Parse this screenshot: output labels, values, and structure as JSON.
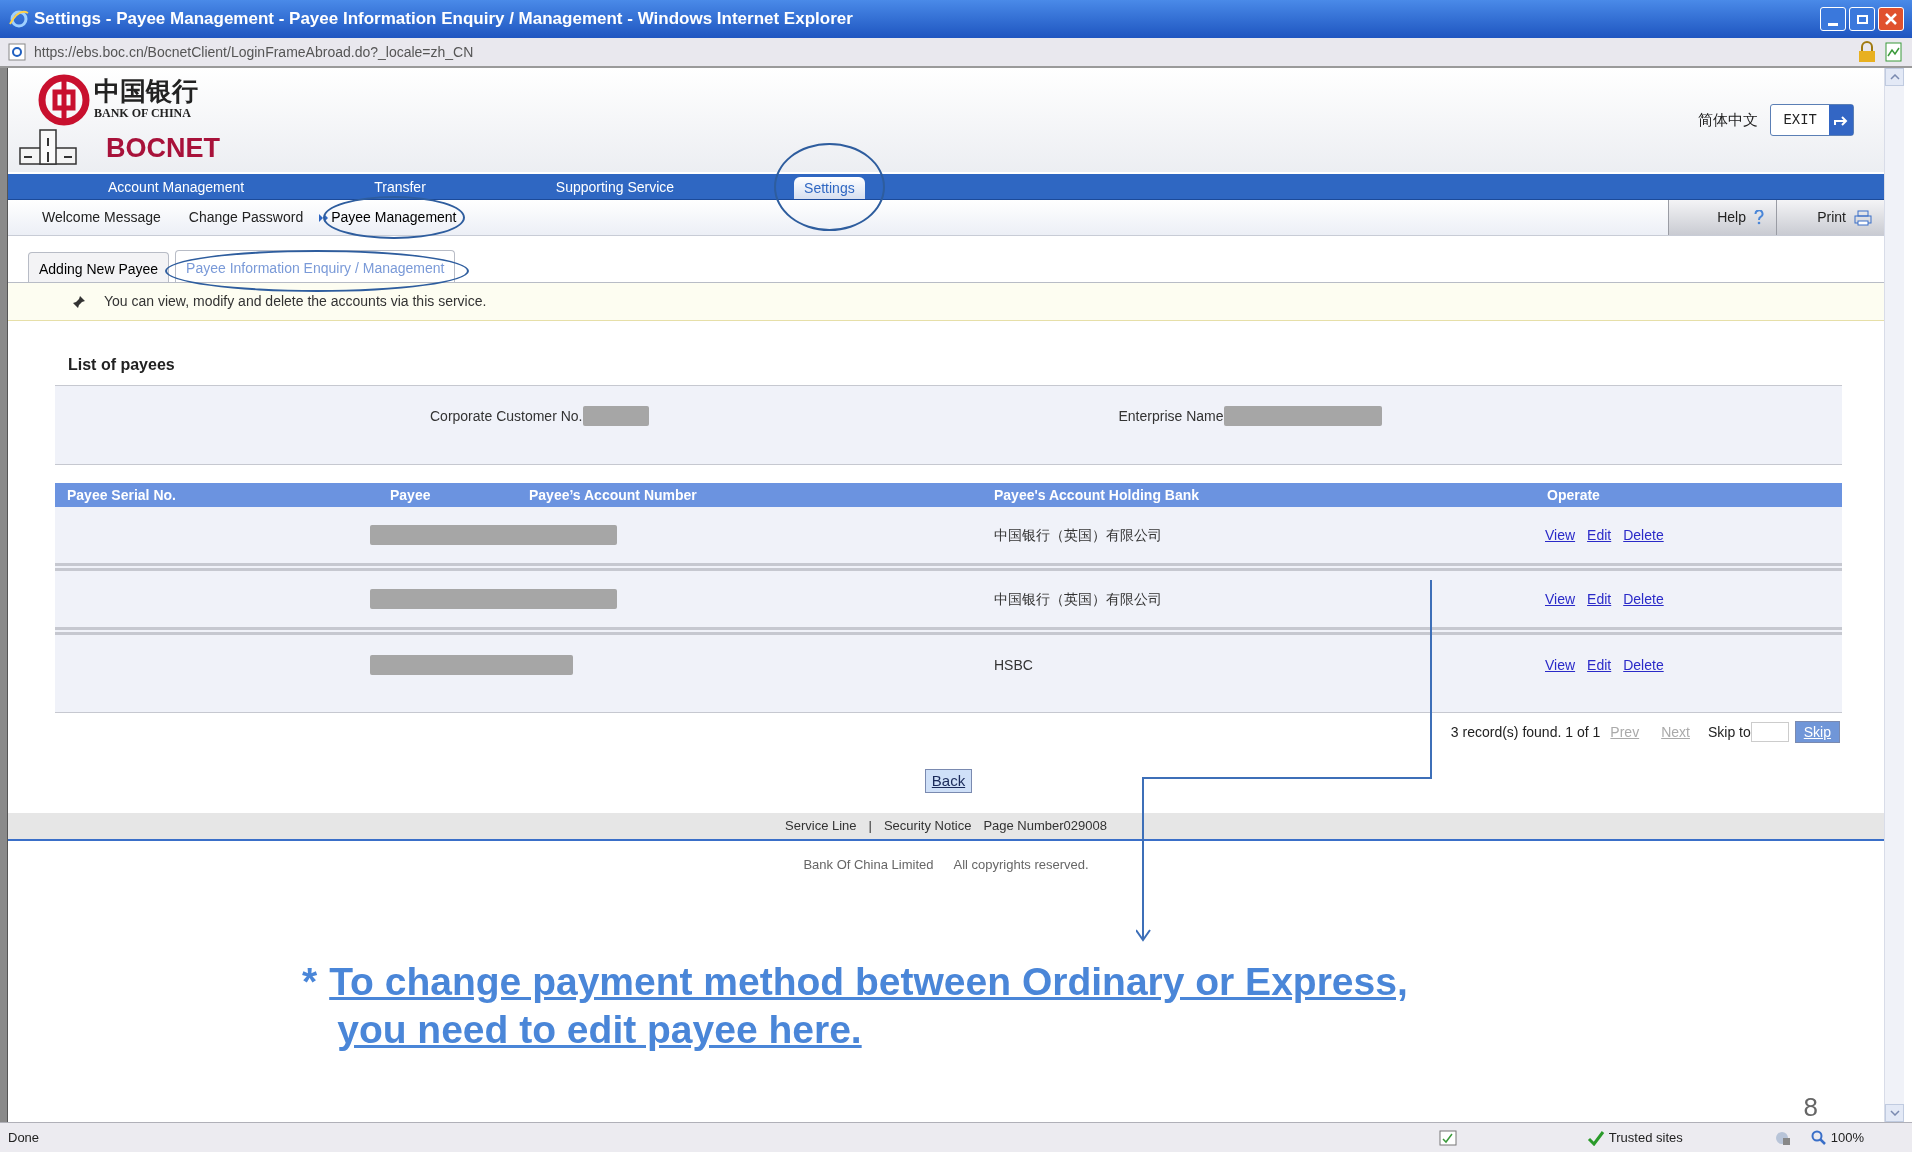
{
  "window": {
    "title": "Settings - Payee Management - Payee Information Enquiry / Management - Windows Internet Explorer"
  },
  "address_bar": {
    "url": "https://ebs.boc.cn/BocnetClient/LoginFrameAbroad.do?_locale=zh_CN"
  },
  "header": {
    "logo_chinese": "中国银行",
    "logo_english": "BANK OF CHINA",
    "product": "BOCNET",
    "language": "简体中文",
    "exit": "EXIT"
  },
  "main_nav": [
    {
      "label": "Account Management",
      "selected": false,
      "circled": false
    },
    {
      "label": "Transfer",
      "selected": false,
      "circled": false
    },
    {
      "label": "Supporting Service",
      "selected": false,
      "circled": false
    },
    {
      "label": "Settings",
      "selected": true,
      "circled": true
    }
  ],
  "sub_nav": [
    {
      "label": "Welcome Message",
      "selected": false,
      "circled": false
    },
    {
      "label": "Change Password",
      "selected": false,
      "circled": false
    },
    {
      "label": "Payee Management",
      "selected": true,
      "circled": true
    }
  ],
  "toolbar": [
    {
      "label": "Help",
      "kind": "help"
    },
    {
      "label": "Print",
      "kind": "print"
    }
  ],
  "tabs": [
    {
      "label": "Adding New Payee",
      "selected": false,
      "circled": false
    },
    {
      "label": "Payee Information Enquiry / Management",
      "selected": true,
      "circled": true
    }
  ],
  "notice": "You can view, modify and delete the accounts via this service.",
  "section_title": "List of payees",
  "info": [
    {
      "label": "Corporate Customer No."
    },
    {
      "label": "Enterprise Name"
    }
  ],
  "table": {
    "columns": [
      "Payee Serial No.",
      "Payee",
      "Payee’s Account Number",
      "Payee's Account Holding Bank",
      "Operate"
    ],
    "rows": [
      {
        "kind": "long",
        "bank": "中国银行（英国）有限公司",
        "actions": [
          "View",
          "Edit",
          "Delete"
        ]
      },
      {
        "kind": "long",
        "bank": "中国银行（英国）有限公司",
        "actions": [
          "View",
          "Edit",
          "Delete"
        ]
      },
      {
        "kind": "short",
        "bank": "HSBC",
        "actions": [
          "View",
          "Edit",
          "Delete"
        ]
      }
    ]
  },
  "pagination": {
    "summary": "3 record(s) found.",
    "page": "1 of 1",
    "prev": {
      "label": "Prev",
      "disabled": true
    },
    "next": {
      "label": "Next",
      "disabled": true
    },
    "skip_label": "Skip to",
    "skip_button": {
      "label": "Skip",
      "disabled": true
    }
  },
  "back_button": "Back",
  "footer": {
    "links": [
      "Service Line",
      "|",
      "Security Notice",
      "Page Number029008"
    ],
    "copyright": [
      "Bank Of China Limited",
      "All copyrights reserved."
    ]
  },
  "annotation": {
    "star": "*",
    "lines": [
      "To change payment method between Ordinary or Express,",
      "you need to edit payee here."
    ]
  },
  "slide_number": "8",
  "status_bar": {
    "status": "Done",
    "zone": "Trusted sites",
    "zoom": "100%"
  }
}
